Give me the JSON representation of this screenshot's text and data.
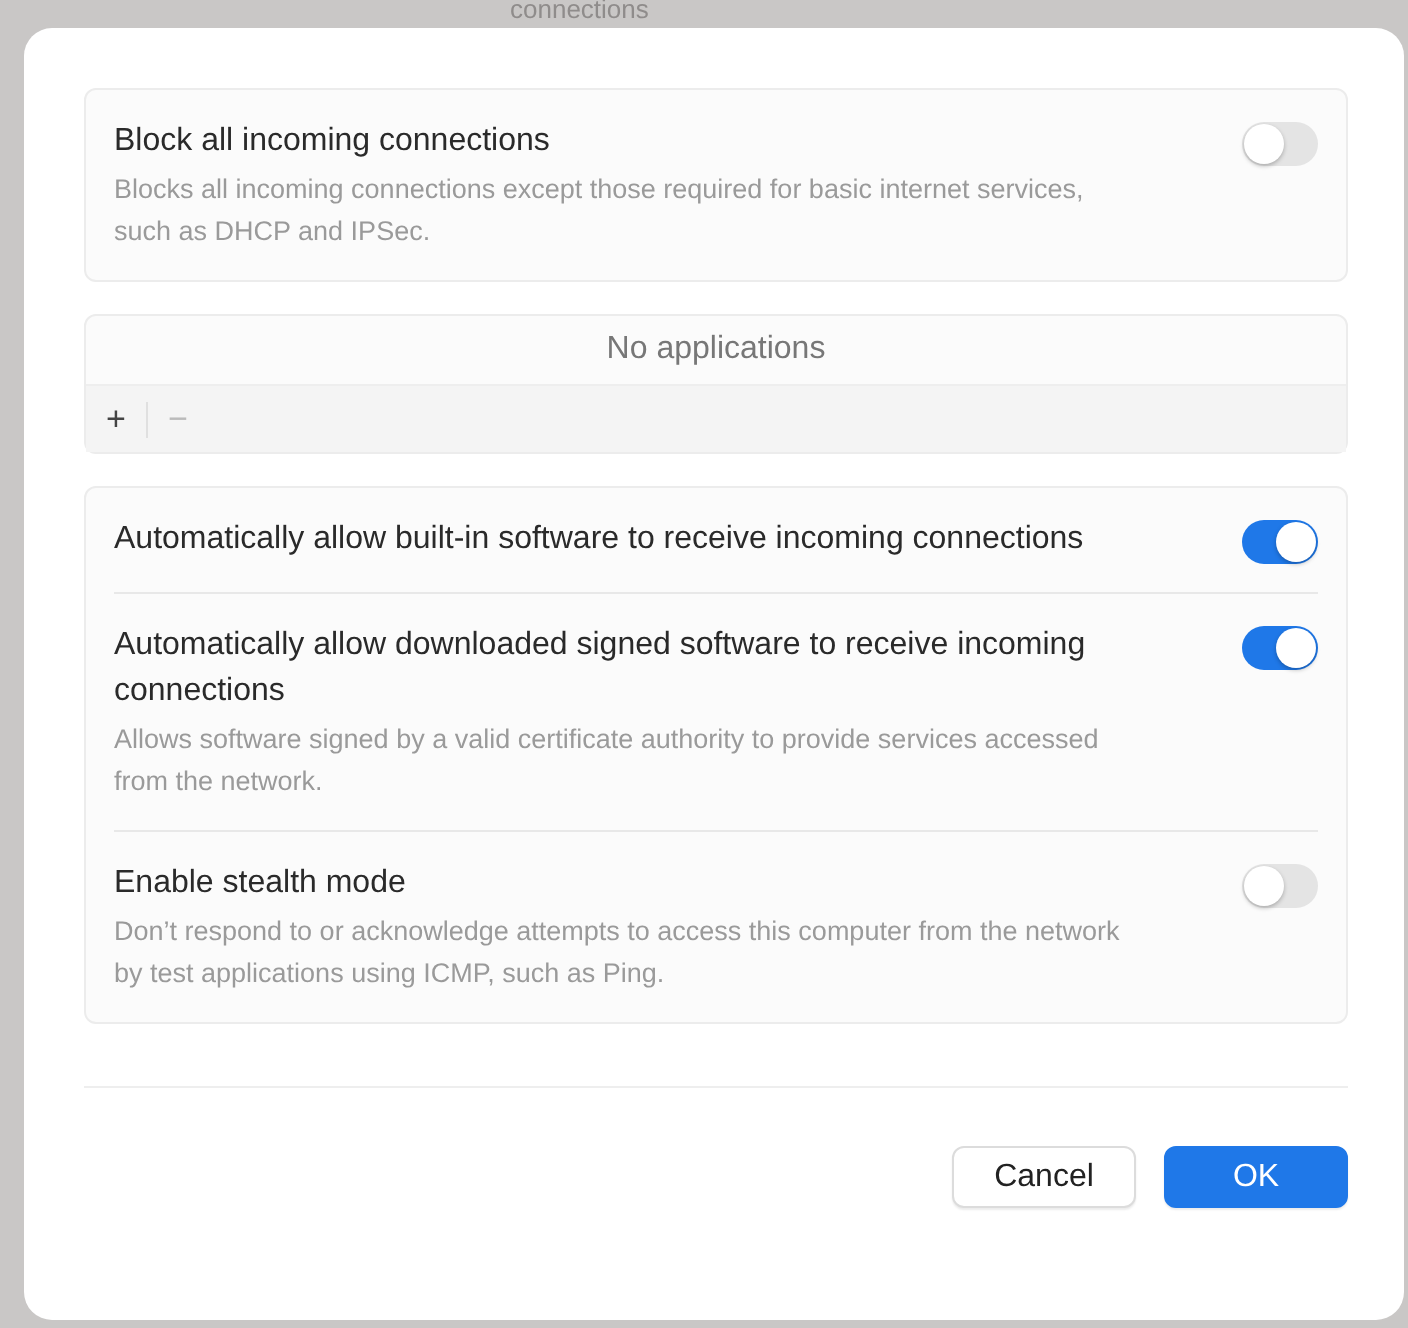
{
  "backdrop": {
    "text": "connections"
  },
  "block": {
    "title": "Block all incoming connections",
    "description": "Blocks all incoming connections except those required for basic internet services, such as DHCP and IPSec.",
    "on": false
  },
  "applications": {
    "empty_text": "No applications",
    "add": "+",
    "remove": "−"
  },
  "options": [
    {
      "title": "Automatically allow built-in software to receive incoming connections",
      "on": true
    },
    {
      "title": "Automatically allow downloaded signed software to receive incoming connections",
      "description": "Allows software signed by a valid certificate authority to provide services accessed from the network.",
      "on": true
    },
    {
      "title": "Enable stealth mode",
      "description": "Don’t respond to or acknowledge attempts to access this computer from the network by test applications using ICMP, such as Ping.",
      "on": false
    }
  ],
  "buttons": {
    "cancel": "Cancel",
    "ok": "OK"
  }
}
